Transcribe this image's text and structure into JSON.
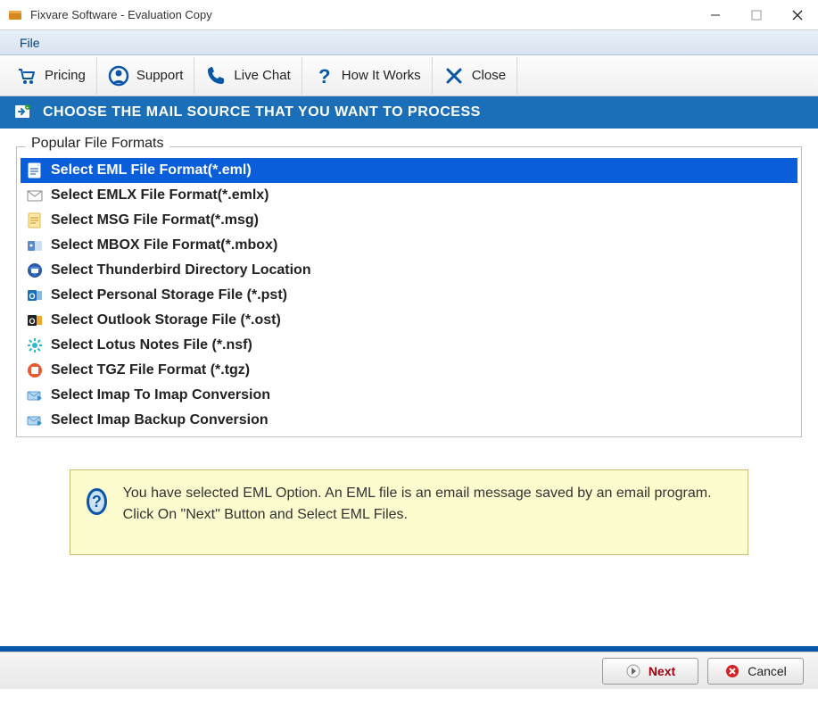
{
  "window": {
    "title": "Fixvare Software - Evaluation Copy"
  },
  "menubar": {
    "file": "File"
  },
  "toolbar": {
    "pricing": "Pricing",
    "support": "Support",
    "livechat": "Live Chat",
    "howitworks": "How It Works",
    "close": "Close"
  },
  "section_header": "CHOOSE THE MAIL SOURCE THAT YOU WANT TO PROCESS",
  "groupbox_title": "Popular File Formats",
  "formats": {
    "eml": "Select EML File Format(*.eml)",
    "emlx": "Select EMLX File Format(*.emlx)",
    "msg": "Select MSG File Format(*.msg)",
    "mbox": "Select MBOX File Format(*.mbox)",
    "thunderbird": "Select Thunderbird Directory Location",
    "pst": "Select Personal Storage File (*.pst)",
    "ost": "Select Outlook Storage File (*.ost)",
    "nsf": "Select Lotus Notes File (*.nsf)",
    "tgz": "Select TGZ File Format (*.tgz)",
    "imap2imap": "Select Imap To Imap Conversion",
    "imapbackup": "Select Imap Backup Conversion"
  },
  "info_text": "You have selected EML Option. An EML file is an email message saved by an email program. Click On \"Next\" Button and Select EML Files.",
  "buttons": {
    "next": "Next",
    "cancel": "Cancel"
  }
}
